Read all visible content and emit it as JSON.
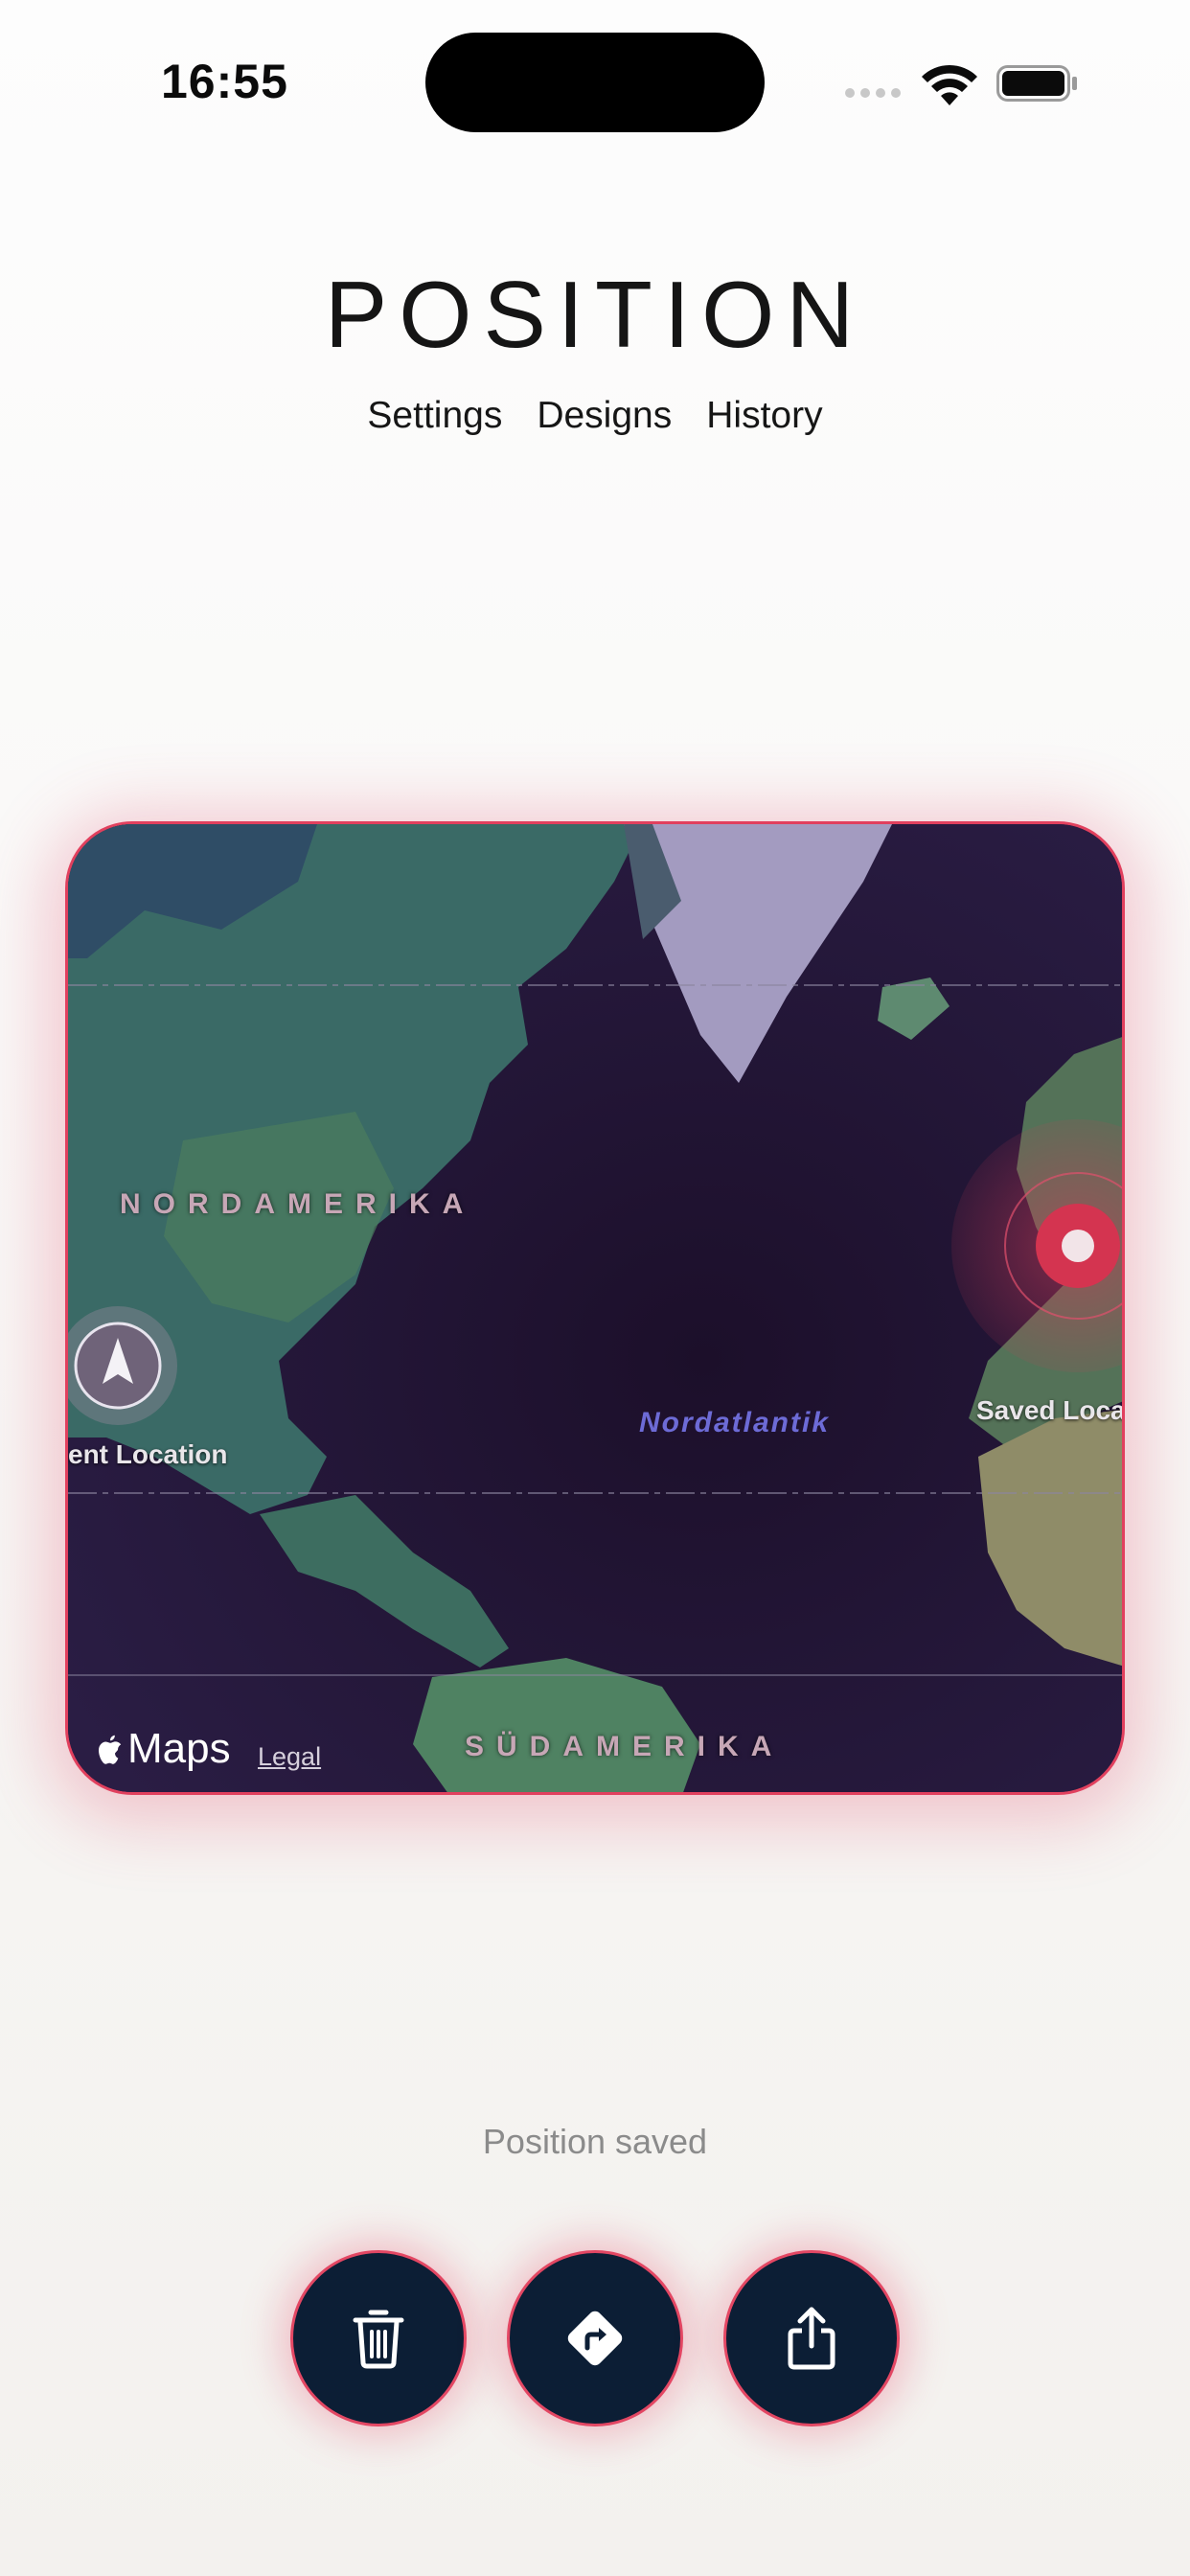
{
  "status_bar": {
    "time": "16:55"
  },
  "header": {
    "title": "POSITION",
    "nav": [
      {
        "label": "Settings"
      },
      {
        "label": "Designs"
      },
      {
        "label": "History"
      }
    ]
  },
  "map": {
    "region_labels": [
      "NORDAMERIKA",
      "SÜDAMERIKA"
    ],
    "ocean_label": "Nordatlantik",
    "current_location_label": "ent Location",
    "saved_location_label": "Saved Loca",
    "brand": "Maps",
    "legal": "Legal"
  },
  "status_message": "Position saved",
  "actions": [
    {
      "name": "delete",
      "icon": "trash-icon"
    },
    {
      "name": "directions",
      "icon": "directions-icon"
    },
    {
      "name": "share",
      "icon": "share-icon"
    }
  ],
  "colors": {
    "accent": "#e1405e",
    "button_fill": "#0c1e35",
    "map_ocean": "#241636"
  }
}
